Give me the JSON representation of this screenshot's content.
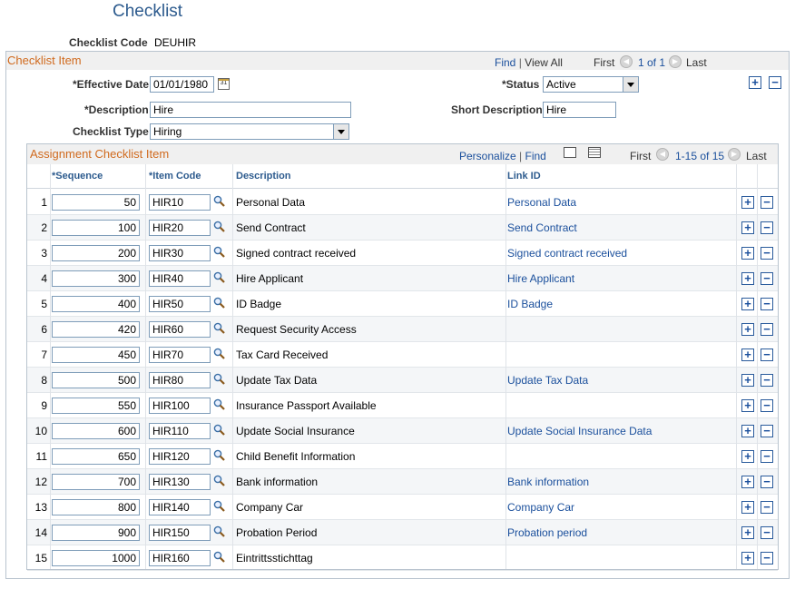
{
  "page": {
    "title": "Checklist",
    "checklist_code_label": "Checklist Code",
    "checklist_code_value": "DEUHIR"
  },
  "checklist_item": {
    "section_title": "Checklist Item",
    "nav": {
      "find": "Find",
      "sep": "|",
      "view_all": "View All",
      "first": "First",
      "range": "1 of 1",
      "last": "Last"
    },
    "effective_date_label": "*Effective Date",
    "effective_date_value": "01/01/1980",
    "calendar_glyph": "31",
    "status_label": "*Status",
    "status_value": "Active",
    "description_label": "*Description",
    "description_value": "Hire",
    "short_description_label": "Short Description",
    "short_description_value": "Hire",
    "checklist_type_label": "Checklist Type",
    "checklist_type_value": "Hiring",
    "add_glyph": "+",
    "remove_glyph": "−"
  },
  "assignment_grid": {
    "section_title": "Assignment Checklist Item",
    "nav": {
      "personalize": "Personalize",
      "sep": "|",
      "find": "Find",
      "first": "First",
      "range": "1-15 of 15",
      "last": "Last"
    },
    "columns": {
      "sequence": "*Sequence",
      "item_code": "*Item Code",
      "description": "Description",
      "link_id": "Link ID"
    },
    "rows": [
      {
        "n": "1",
        "seq": "50",
        "code": "HIR10",
        "desc": "Personal Data",
        "link": "Personal Data"
      },
      {
        "n": "2",
        "seq": "100",
        "code": "HIR20",
        "desc": "Send Contract",
        "link": "Send Contract"
      },
      {
        "n": "3",
        "seq": "200",
        "code": "HIR30",
        "desc": "Signed contract received",
        "link": "Signed contract received"
      },
      {
        "n": "4",
        "seq": "300",
        "code": "HIR40",
        "desc": "Hire Applicant",
        "link": "Hire Applicant"
      },
      {
        "n": "5",
        "seq": "400",
        "code": "HIR50",
        "desc": "ID Badge",
        "link": "ID Badge"
      },
      {
        "n": "6",
        "seq": "420",
        "code": "HIR60",
        "desc": "Request Security Access",
        "link": ""
      },
      {
        "n": "7",
        "seq": "450",
        "code": "HIR70",
        "desc": "Tax Card Received",
        "link": ""
      },
      {
        "n": "8",
        "seq": "500",
        "code": "HIR80",
        "desc": "Update Tax Data",
        "link": "Update Tax Data"
      },
      {
        "n": "9",
        "seq": "550",
        "code": "HIR100",
        "desc": "Insurance Passport Available",
        "link": ""
      },
      {
        "n": "10",
        "seq": "600",
        "code": "HIR110",
        "desc": "Update Social Insurance",
        "link": "Update Social Insurance Data"
      },
      {
        "n": "11",
        "seq": "650",
        "code": "HIR120",
        "desc": "Child Benefit Information",
        "link": ""
      },
      {
        "n": "12",
        "seq": "700",
        "code": "HIR130",
        "desc": "Bank information",
        "link": "Bank information"
      },
      {
        "n": "13",
        "seq": "800",
        "code": "HIR140",
        "desc": "Company Car",
        "link": "Company Car"
      },
      {
        "n": "14",
        "seq": "900",
        "code": "HIR150",
        "desc": "Probation Period",
        "link": "Probation period"
      },
      {
        "n": "15",
        "seq": "1000",
        "code": "HIR160",
        "desc": "Eintrittsstichttag",
        "link": ""
      }
    ]
  },
  "colors": {
    "title": "#2d5b8e",
    "section": "#d06a1e",
    "link": "#1a4f9c"
  },
  "icons": {
    "lookup": "magnifier-icon",
    "calendar": "calendar-icon",
    "prev": "arrow-left-icon",
    "next": "arrow-right-icon"
  }
}
